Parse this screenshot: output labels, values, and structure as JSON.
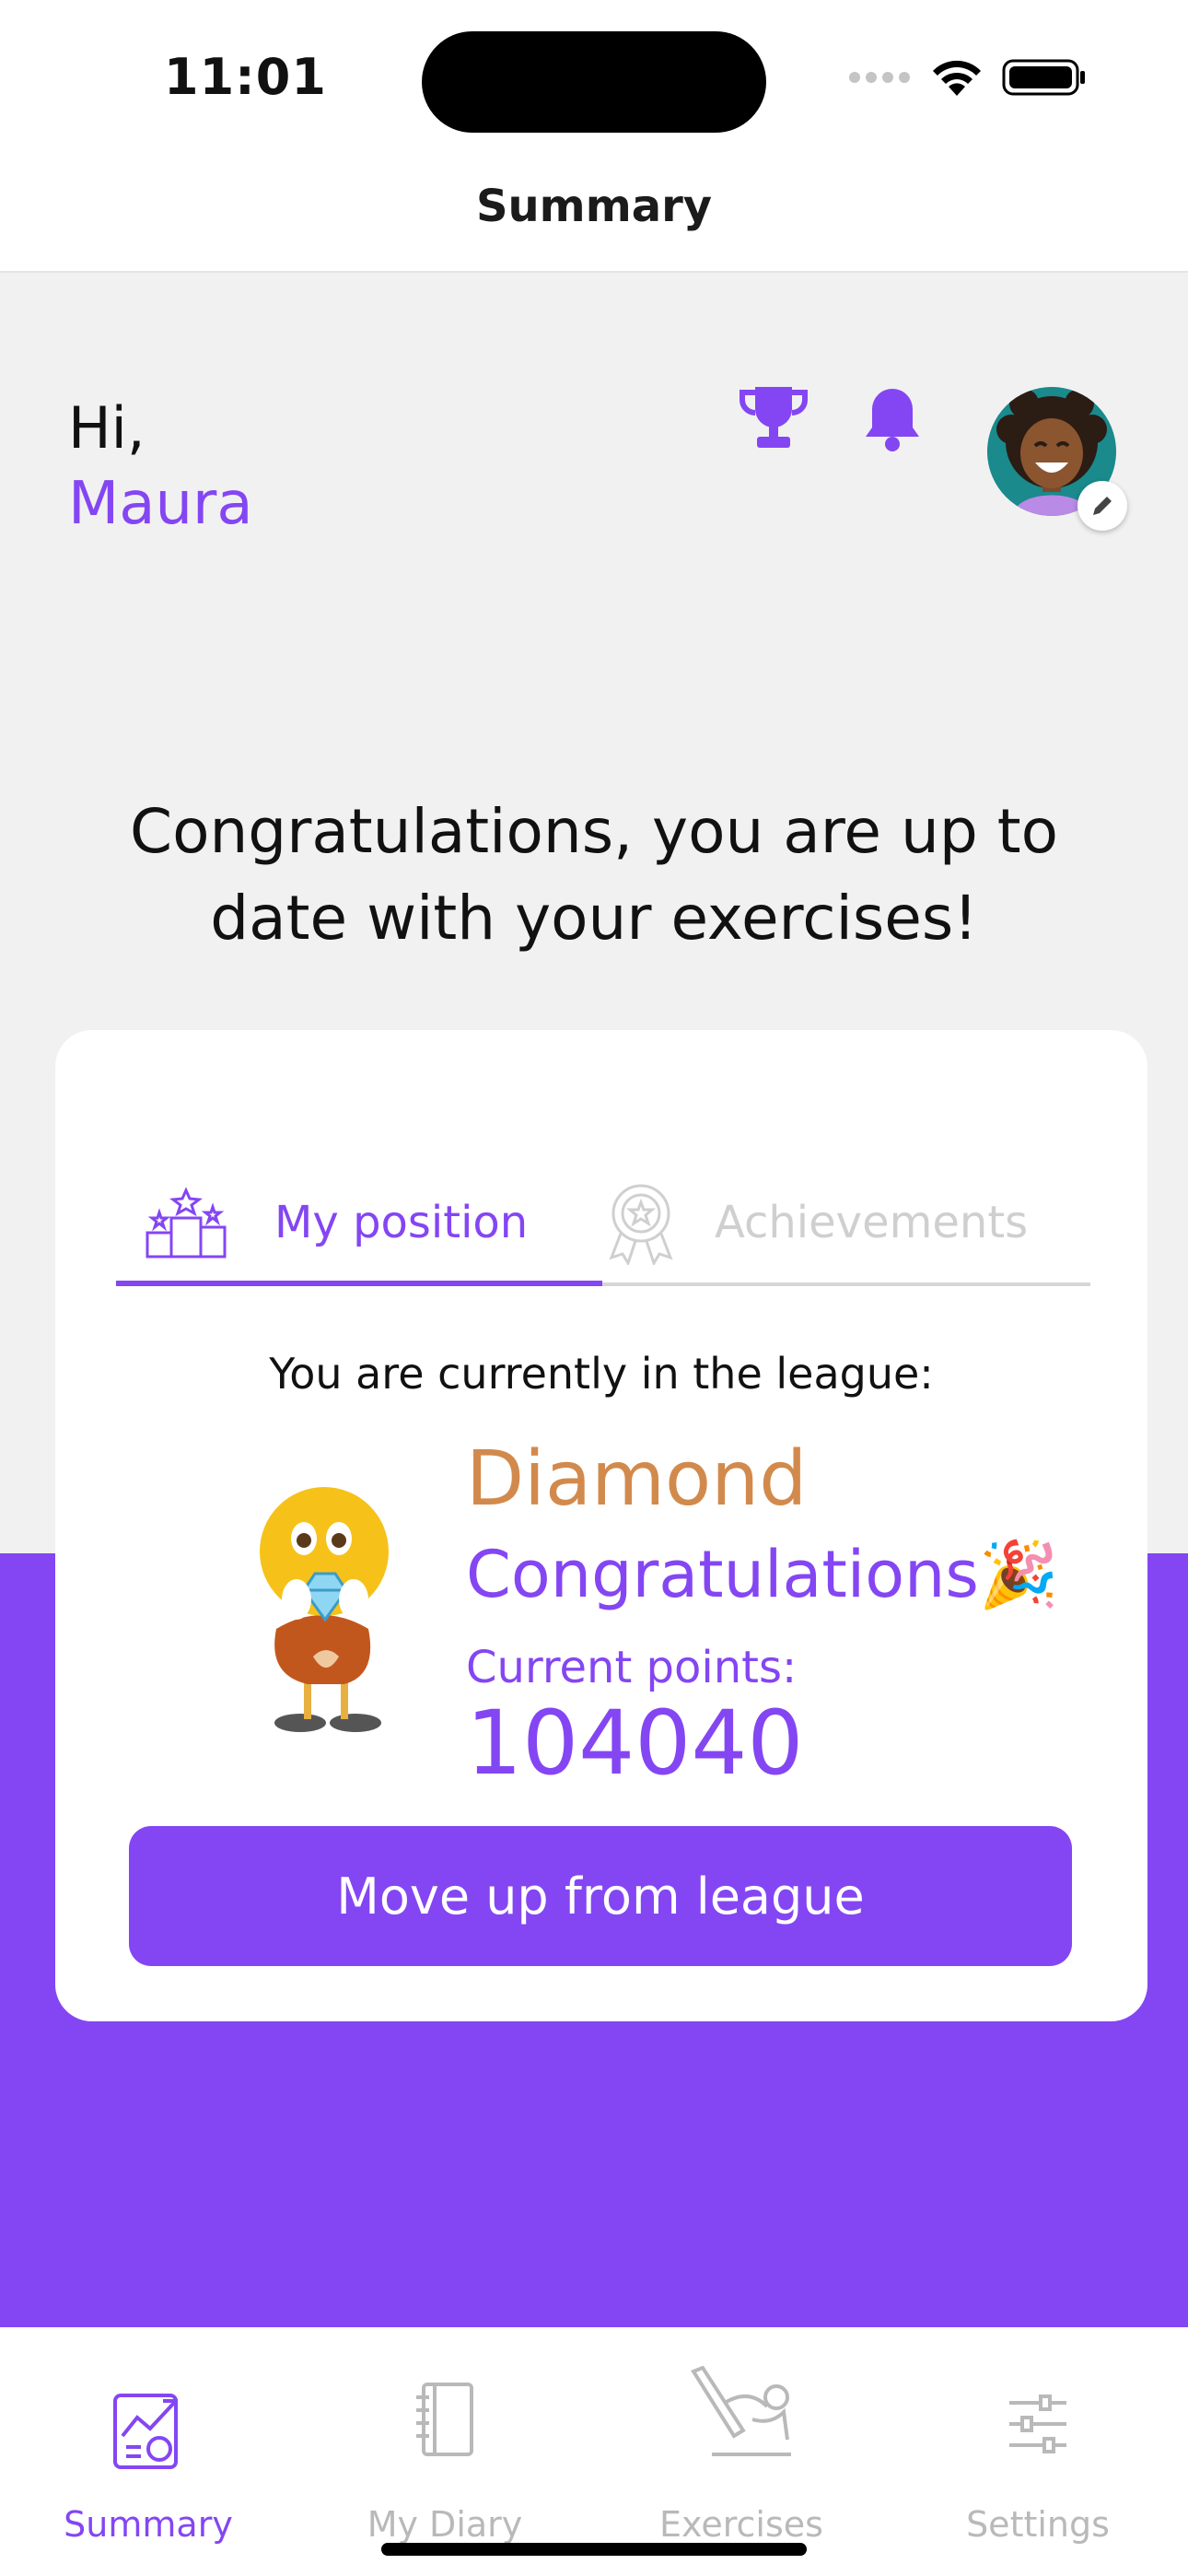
{
  "status_bar": {
    "time": "11:01"
  },
  "nav": {
    "title": "Summary"
  },
  "greeting": {
    "hi": "Hi,",
    "name": "Maura"
  },
  "header_icons": [
    "trophy-icon",
    "bell-icon",
    "avatar",
    "pencil-icon"
  ],
  "message": "Congratulations, you are up to date with your exercises!",
  "card": {
    "tabs": [
      {
        "label": "My position",
        "icon": "podium-icon",
        "active": true
      },
      {
        "label": "Achievements",
        "icon": "award-ribbon-icon",
        "active": false
      }
    ],
    "league_intro": "You are currently in the league:",
    "league_name": "Diamond",
    "league_congrats": "Congratulations🎉",
    "points_label": "Current points:",
    "points_value": "104040",
    "button_label": "Move up from league"
  },
  "tab_bar": [
    {
      "label": "Summary",
      "icon": "summary-chart-icon",
      "active": true
    },
    {
      "label": "My Diary",
      "icon": "notebook-icon",
      "active": false
    },
    {
      "label": "Exercises",
      "icon": "exercise-icon",
      "active": false
    },
    {
      "label": "Settings",
      "icon": "sliders-icon",
      "active": false
    }
  ],
  "colors": {
    "accent": "#8446f3",
    "league": "#d28a4c",
    "background": "#f1f1f1"
  }
}
